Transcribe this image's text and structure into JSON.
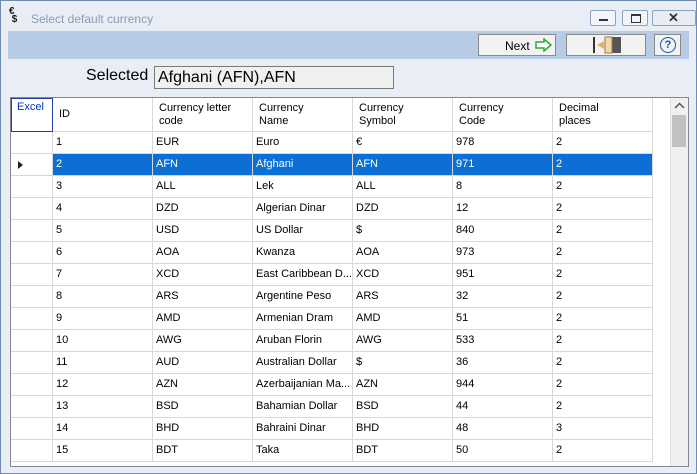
{
  "window": {
    "title": "Select default currency"
  },
  "toolbar": {
    "next_label": "Next",
    "help_label": "?"
  },
  "selected": {
    "label": "Selected",
    "value": "Afghani (AFN),AFN"
  },
  "grid": {
    "corner_label": "Excel",
    "columns": [
      "ID",
      "Currency letter code",
      "Currency Name",
      "Currency Symbol",
      "Currency Code",
      "Decimal places"
    ],
    "column_lines": [
      [
        "ID"
      ],
      [
        "Currency letter",
        "code"
      ],
      [
        "Currency",
        "Name"
      ],
      [
        "Currency",
        "Symbol"
      ],
      [
        "Currency",
        "Code"
      ],
      [
        "Decimal",
        "places"
      ]
    ],
    "selected_row": 1,
    "rows": [
      [
        "1",
        "EUR",
        "Euro",
        "€",
        "978",
        "2"
      ],
      [
        "2",
        "AFN",
        "Afghani",
        "AFN",
        "971",
        "2"
      ],
      [
        "3",
        "ALL",
        "Lek",
        "ALL",
        "8",
        "2"
      ],
      [
        "4",
        "DZD",
        "Algerian Dinar",
        "DZD",
        "12",
        "2"
      ],
      [
        "5",
        "USD",
        "US Dollar",
        "$",
        "840",
        "2"
      ],
      [
        "6",
        "AOA",
        "Kwanza",
        "AOA",
        "973",
        "2"
      ],
      [
        "7",
        "XCD",
        "East Caribbean D...",
        "XCD",
        "951",
        "2"
      ],
      [
        "8",
        "ARS",
        "Argentine Peso",
        "ARS",
        "32",
        "2"
      ],
      [
        "9",
        "AMD",
        "Armenian Dram",
        "AMD",
        "51",
        "2"
      ],
      [
        "10",
        "AWG",
        "Aruban Florin",
        "AWG",
        "533",
        "2"
      ],
      [
        "11",
        "AUD",
        "Australian Dollar",
        "$",
        "36",
        "2"
      ],
      [
        "12",
        "AZN",
        "Azerbaijanian Ma...",
        "AZN",
        "944",
        "2"
      ],
      [
        "13",
        "BSD",
        "Bahamian Dollar",
        "BSD",
        "44",
        "2"
      ],
      [
        "14",
        "BHD",
        "Bahraini Dinar",
        "BHD",
        "48",
        "3"
      ],
      [
        "15",
        "BDT",
        "Taka",
        "BDT",
        "50",
        "2"
      ]
    ]
  },
  "colors": {
    "selection": "#0b6fd6",
    "toolbar": "#b7cbe4",
    "window_bg": "#e9eef6",
    "next_arrow": "#2fa82f"
  }
}
